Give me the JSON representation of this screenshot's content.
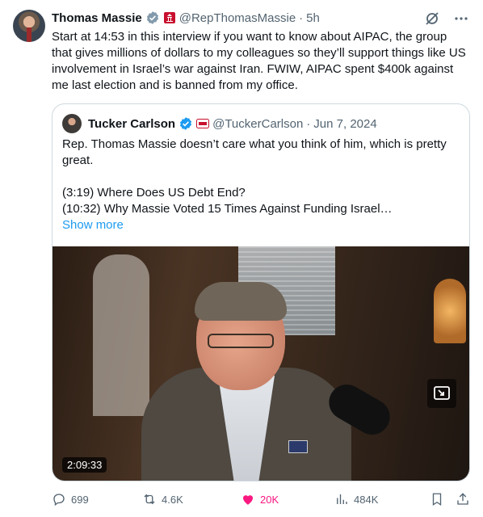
{
  "tweet": {
    "author_name": "Thomas Massie",
    "handle": "@RepThomasMassie",
    "separator": "·",
    "time": "5h",
    "text": "Start at 14:53 in this interview if you want to know about AIPAC, the group that gives millions of dollars to my colleagues so they’ll support things like US involvement in Israel’s war against Iran. FWIW, AIPAC spent $400k against me last election and is banned from my office."
  },
  "quote": {
    "author_name": "Tucker Carlson",
    "handle": "@TuckerCarlson",
    "separator": "·",
    "date": "Jun 7, 2024",
    "line1": "Rep. Thomas Massie doesn’t care what you think of him, which is pretty great.",
    "line2": "(3:19) Where Does US Debt End?",
    "line3": "(10:32) Why Massie Voted 15 Times Against Funding Israel…",
    "show_more": "Show more",
    "video_duration": "2:09:33"
  },
  "actions": {
    "replies": "699",
    "reposts": "4.6K",
    "likes": "20K",
    "views": "484K"
  },
  "icons": {
    "verified": "verified-check-icon",
    "affiliation": "us-house-badge-icon",
    "grok": "grok-icon",
    "more": "more-dots-icon",
    "reply": "reply-icon",
    "repost": "repost-icon",
    "like": "heart-icon",
    "views": "views-icon",
    "bookmark": "bookmark-icon",
    "share": "share-icon",
    "pip": "picture-in-picture-icon"
  },
  "colors": {
    "accent": "#1d9bf0",
    "like": "#f91880",
    "muted": "#536471"
  }
}
